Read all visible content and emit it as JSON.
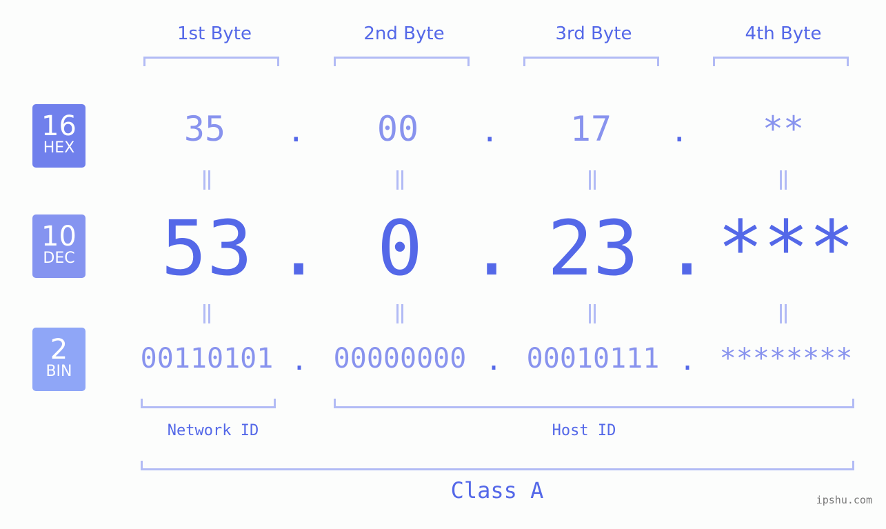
{
  "badges": [
    {
      "num": "16",
      "label": "HEX",
      "color": "#7080ec"
    },
    {
      "num": "10",
      "label": "DEC",
      "color": "#8594f0"
    },
    {
      "num": "2",
      "label": "BIN",
      "color": "#8fa6f7"
    }
  ],
  "bytes": [
    {
      "label": "1st Byte",
      "hex": "35",
      "dec": "53",
      "bin": "00110101"
    },
    {
      "label": "2nd Byte",
      "hex": "00",
      "dec": "0",
      "bin": "00000000"
    },
    {
      "label": "3rd Byte",
      "hex": "17",
      "dec": "23",
      "bin": "00010111"
    },
    {
      "label": "4th Byte",
      "hex": "**",
      "dec": "***",
      "bin": "********"
    }
  ],
  "separator": ".",
  "network_id_label": "Network ID",
  "host_id_label": "Host ID",
  "class_label": "Class A",
  "watermark": "ipshu.com",
  "colors": {
    "accent": "#5468e8",
    "light": "#8893ee",
    "bracket": "#b2bbf5"
  }
}
